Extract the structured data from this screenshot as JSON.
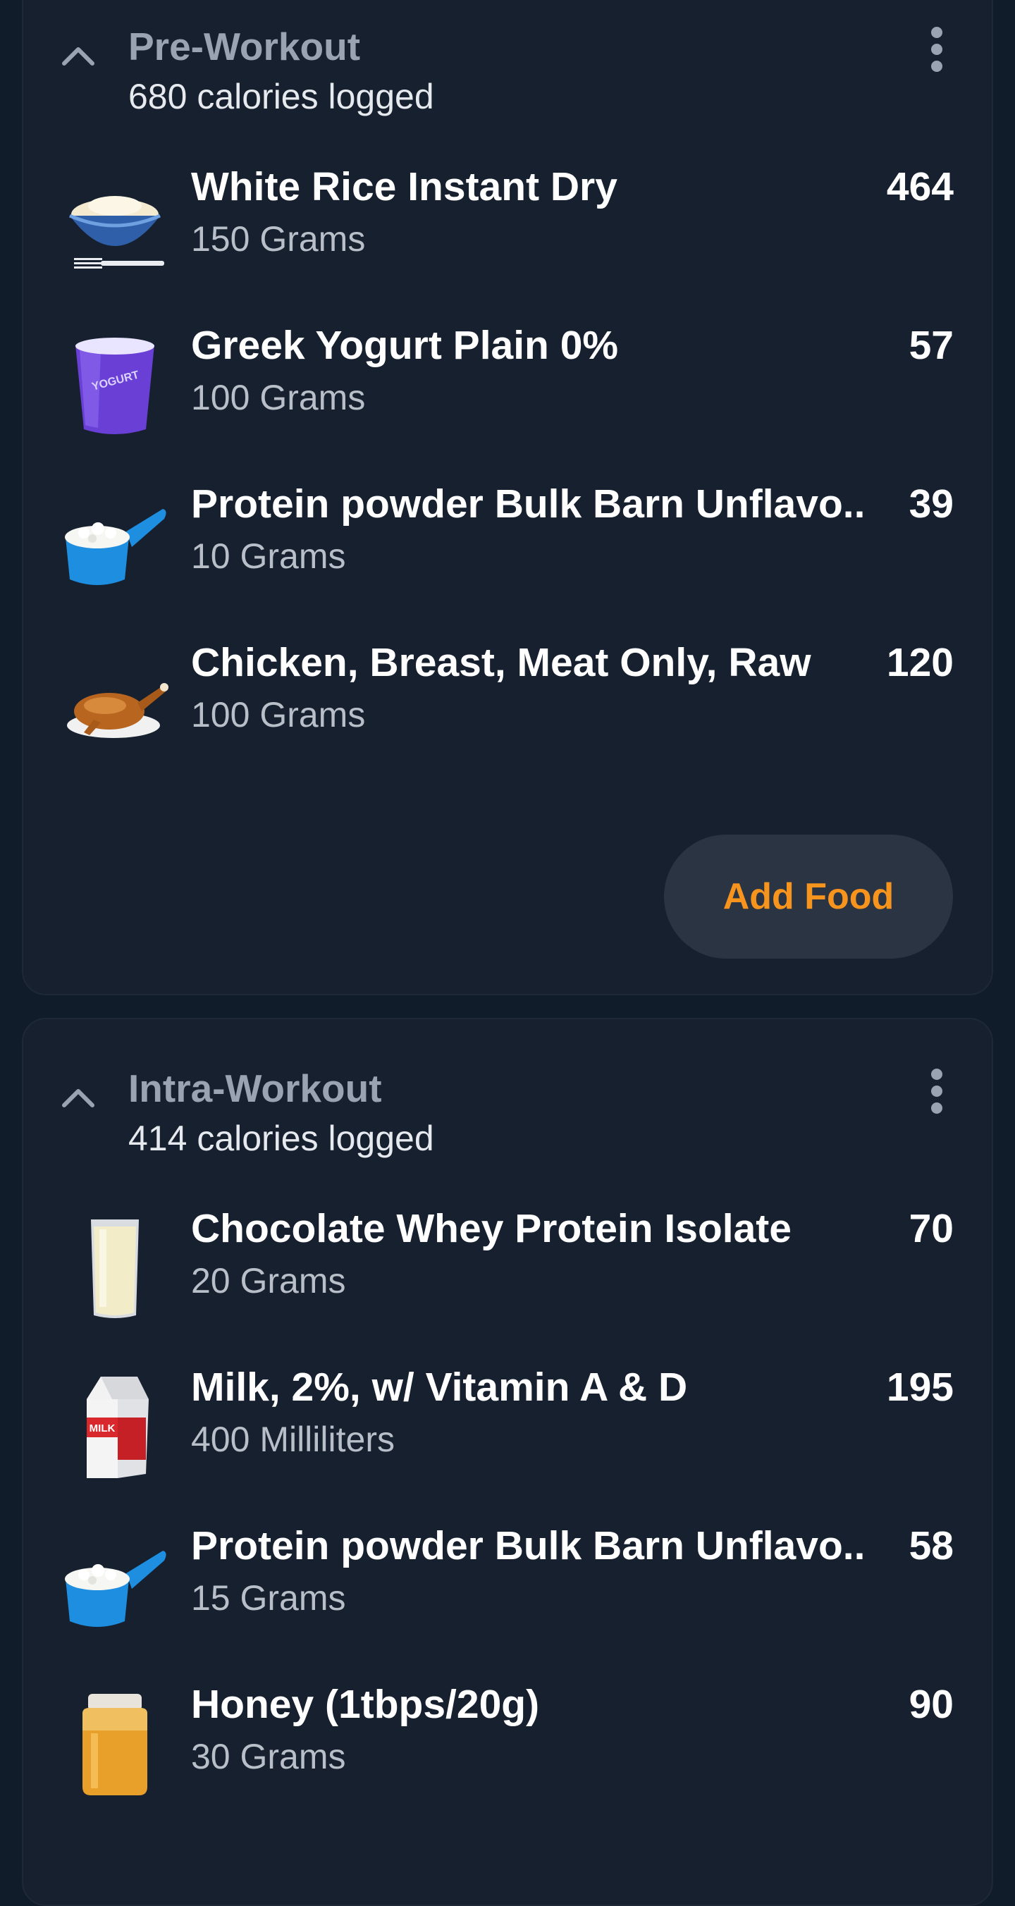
{
  "colors": {
    "background": "#111c2b",
    "card": "#17202f",
    "accent": "#f7941d",
    "button_bg": "#2a3442",
    "muted_title": "#9aa3b2"
  },
  "sections": [
    {
      "title": "Pre-Workout",
      "subtitle": "680 calories logged",
      "items": [
        {
          "icon": "rice-bowl-icon",
          "name": "White Rice Instant Dry",
          "serving": "150 Grams",
          "calories": "464"
        },
        {
          "icon": "yogurt-cup-icon",
          "name": "Greek Yogurt Plain 0%",
          "serving": "100 Grams",
          "calories": "57"
        },
        {
          "icon": "protein-scoop-icon",
          "name": "Protein powder Bulk Barn Unflavo..",
          "serving": "10 Grams",
          "calories": "39"
        },
        {
          "icon": "roast-chicken-icon",
          "name": "Chicken, Breast, Meat Only, Raw",
          "serving": "100 Grams",
          "calories": "120"
        }
      ],
      "add_food_label": "Add Food"
    },
    {
      "title": "Intra-Workout",
      "subtitle": "414 calories logged",
      "items": [
        {
          "icon": "milk-glass-icon",
          "name": "Chocolate Whey Protein Isolate",
          "serving": "20 Grams",
          "calories": "70"
        },
        {
          "icon": "milk-carton-icon",
          "name": "Milk, 2%, w/ Vitamin A & D",
          "serving": "400 Milliliters",
          "calories": "195",
          "icon_text": "MILK"
        },
        {
          "icon": "protein-scoop-icon",
          "name": "Protein powder Bulk Barn Unflavo..",
          "serving": "15 Grams",
          "calories": "58"
        },
        {
          "icon": "honey-jar-icon",
          "name": "Honey (1tbps/20g)",
          "serving": "30 Grams",
          "calories": "90"
        }
      ]
    }
  ],
  "yogurt_label": "YOGURT"
}
